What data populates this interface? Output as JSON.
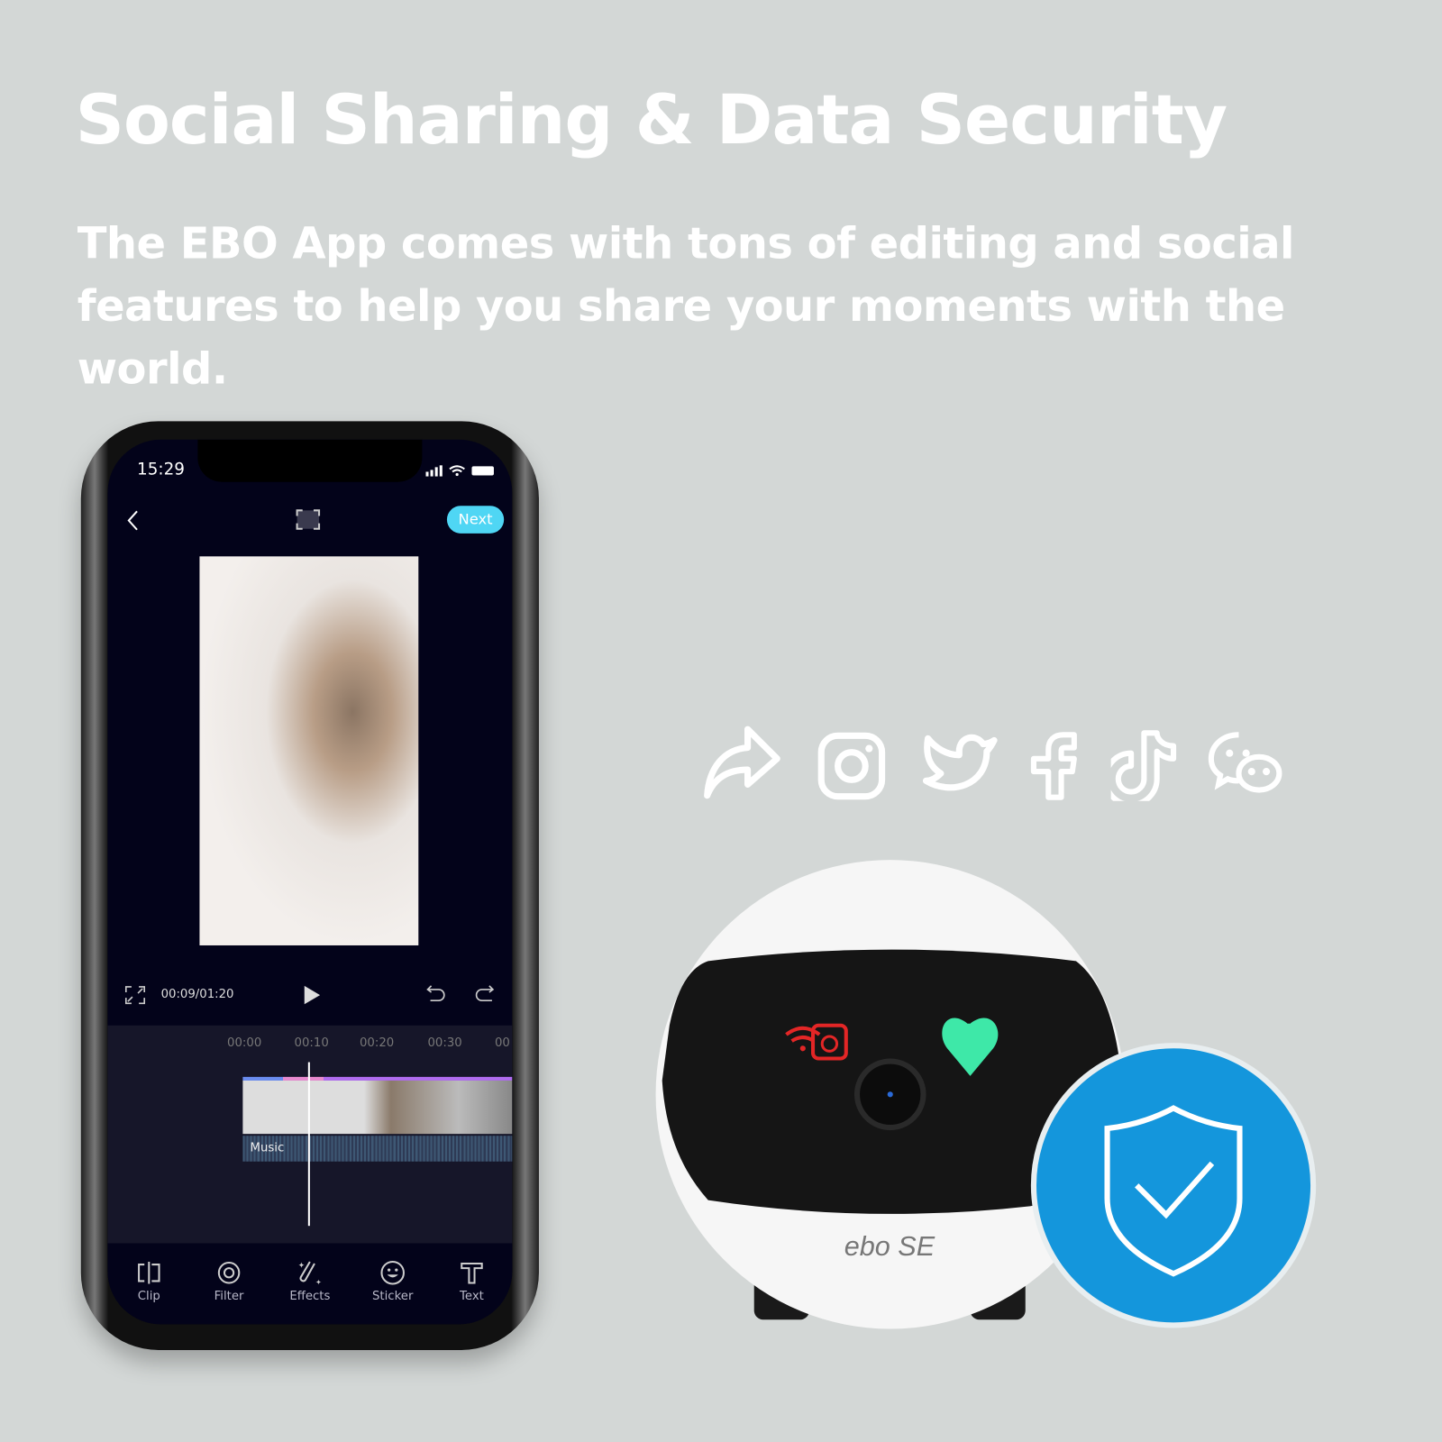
{
  "headline": "Social Sharing & Data Security",
  "subheadline": "The EBO App comes with tons of editing and social features to help you share your moments with the world.",
  "phone": {
    "status_time": "15:29",
    "next_label": "Next",
    "playback_time": "00:09/01:20",
    "timeline_ticks": [
      "00:00",
      "00:10",
      "00:20",
      "00:30",
      "00"
    ],
    "music_label": "Music",
    "toolbar": [
      {
        "label": "Clip",
        "icon": "clip-icon"
      },
      {
        "label": "Filter",
        "icon": "filter-icon"
      },
      {
        "label": "Effects",
        "icon": "effects-icon"
      },
      {
        "label": "Sticker",
        "icon": "sticker-icon"
      },
      {
        "label": "Text",
        "icon": "text-icon"
      }
    ]
  },
  "social_icons": [
    "share-icon",
    "instagram-icon",
    "twitter-icon",
    "facebook-icon",
    "tiktok-icon",
    "wechat-icon"
  ],
  "robot_logo": "ebo SE",
  "colors": {
    "accent": "#4fd6f4",
    "shield": "#1496dc",
    "background": "#d3d7d6"
  }
}
